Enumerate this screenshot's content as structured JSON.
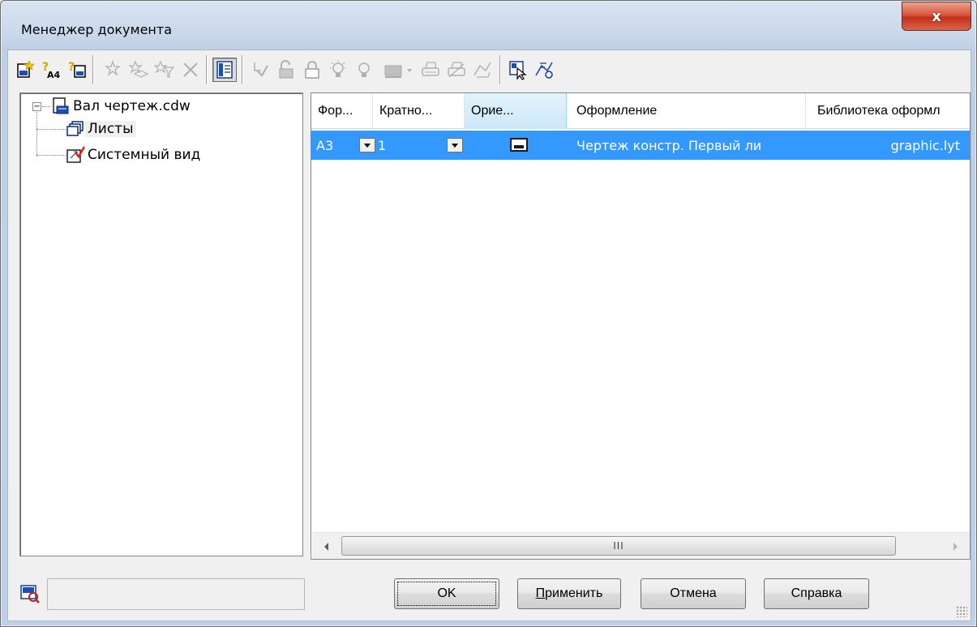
{
  "window": {
    "title": "Менеджер документа",
    "close_label": "x"
  },
  "toolbar": {
    "icons": [
      "new-sheet-icon",
      "sheet-format-icon",
      "sheet-properties-icon",
      "new-view-icon",
      "new-layer-icon",
      "layer-filter-icon",
      "delete-icon",
      "show-panel-icon",
      "current-icon",
      "unlock-icon",
      "lock-icon",
      "show-icon",
      "hide-icon",
      "color-icon",
      "print-icon",
      "print-off-icon",
      "export-icon",
      "select-icon",
      "check-icon"
    ]
  },
  "tree": {
    "root": "Вал чертеж.cdw",
    "children": [
      "Листы",
      "Системный вид"
    ],
    "selected": "Листы"
  },
  "grid": {
    "columns": [
      "Фор...",
      "Кратно...",
      "Орие...",
      "Оформление",
      "Библиотека оформл"
    ],
    "rows": [
      {
        "format": "A3",
        "multiplicity": "1",
        "orientation_icon": "landscape-orientation-icon",
        "layout": "Чертеж констр. Первый ли",
        "library": "graphic.lyt"
      }
    ],
    "scroll_thumb_label": "III"
  },
  "buttons": {
    "ok": "OK",
    "apply_prefix": "П",
    "apply_rest": "рименить",
    "cancel": "Отмена",
    "help": "Справка"
  },
  "status": {
    "value": ""
  },
  "colors": {
    "selection": "#3399ff",
    "header_hot": "#cce8f8",
    "window_frame": "#bfd0e6"
  }
}
